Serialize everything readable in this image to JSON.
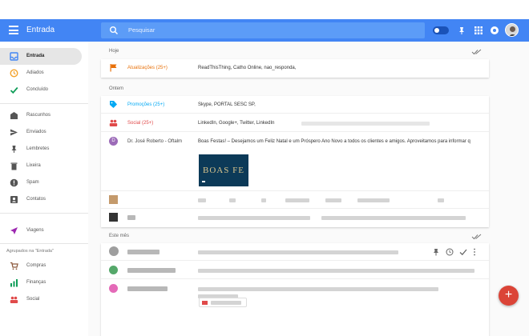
{
  "header": {
    "title": "Entrada",
    "search_placeholder": "Pesquisar"
  },
  "sidebar": {
    "items": [
      {
        "label": "Entrada",
        "icon": "inbox-icon"
      },
      {
        "label": "Adiados",
        "icon": "clock-icon"
      },
      {
        "label": "Concluído",
        "icon": "check-icon"
      },
      {
        "label": "Rascunhos",
        "icon": "drafts-icon"
      },
      {
        "label": "Enviados",
        "icon": "send-icon"
      },
      {
        "label": "Lembretes",
        "icon": "reminder-icon"
      },
      {
        "label": "Lixeira",
        "icon": "trash-icon"
      },
      {
        "label": "Spam",
        "icon": "spam-icon"
      },
      {
        "label": "Contatos",
        "icon": "contacts-icon"
      },
      {
        "label": "Viagens",
        "icon": "plane-icon"
      }
    ],
    "group_heading": "Agrupados na \"Entrada\"",
    "groups": [
      {
        "label": "Compras",
        "icon": "cart-icon"
      },
      {
        "label": "Finanças",
        "icon": "finance-icon"
      },
      {
        "label": "Social",
        "icon": "people-icon"
      }
    ]
  },
  "sections": {
    "hoje": "Hoje",
    "ontem": "Ontem",
    "mes": "Este mês"
  },
  "rows": {
    "atualizacoes": {
      "name": "Atualizações",
      "count": "(25+)",
      "text": "ReadThisThing, Catho Online, nao_responda,"
    },
    "promocoes": {
      "name": "Promoções",
      "count": "(25+)",
      "text": "Skype, PORTAL SESC SP,"
    },
    "social": {
      "name": "Social",
      "count": "(25+)",
      "text": "LinkedIn, Google+, Twitter, LinkedIn"
    },
    "jose": {
      "initial": "D",
      "name": "Dr. José Roberto - Oftalm",
      "text": "Boas Festas! – Desejamos um Feliz Natal e um Próspero Ano Novo a todos os clientes e amigos. Aproveitamos para informar q"
    },
    "promo_image_text": "BOAS FE"
  },
  "colors": {
    "header": "#4285f4",
    "fab": "#db4437",
    "updates": "#e8710a",
    "promotions": "#03a9f4",
    "social": "#e04a4a"
  },
  "fab_label": "+"
}
